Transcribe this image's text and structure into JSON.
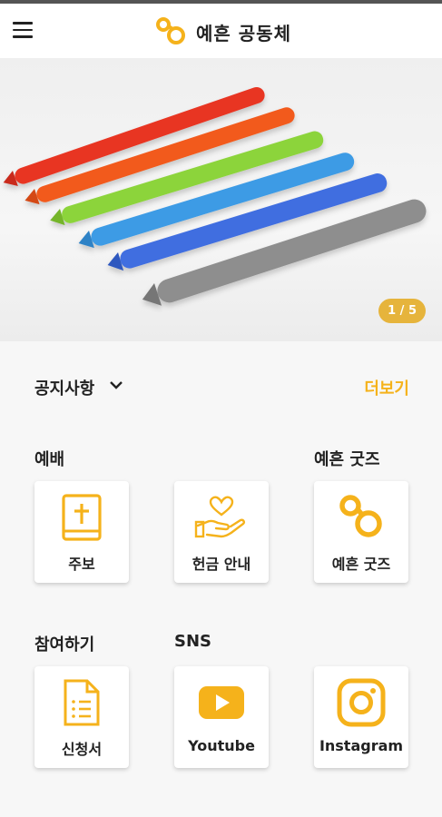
{
  "header": {
    "title": "예흔 공동체"
  },
  "banner": {
    "page_indicator": "1 / 5"
  },
  "notice": {
    "title": "공지사항",
    "more_label": "더보기"
  },
  "sections": {
    "worship": "예배",
    "goods": "예흔 굿즈",
    "participate": "참여하기",
    "sns": "SNS"
  },
  "tiles": {
    "bulletin": "주보",
    "offering": "헌금 안내",
    "goods": "예흔 굿즈",
    "application": "신청서",
    "youtube": "Youtube",
    "instagram": "Instagram"
  },
  "colors": {
    "accent": "#f5b21b",
    "background": "#f7f7f7"
  }
}
